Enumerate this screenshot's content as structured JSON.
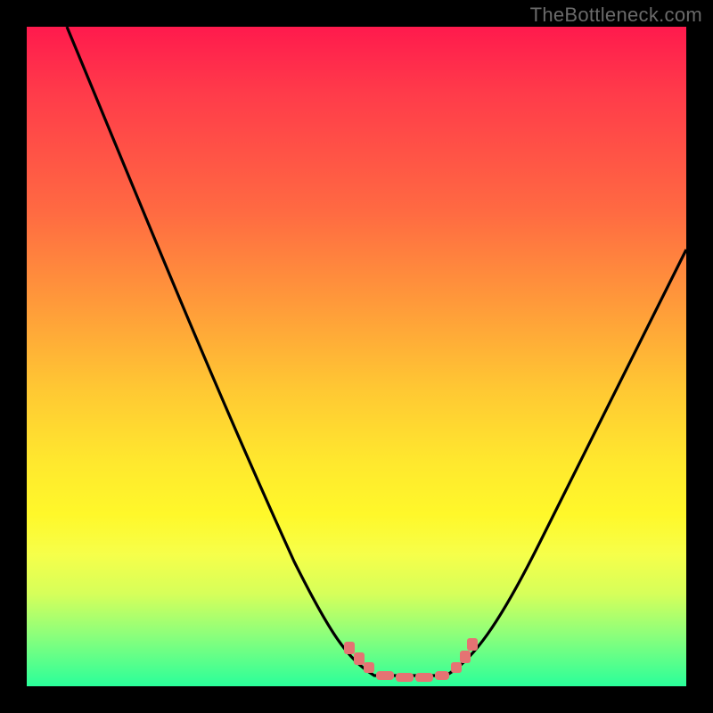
{
  "watermark": "TheBottleneck.com",
  "colors": {
    "frame_background": "#000000",
    "curve_stroke": "#000000",
    "dip_marker": "#e57373",
    "gradient_stops": [
      "#ff1a4d",
      "#ff3b4a",
      "#ff6a42",
      "#ff9a3a",
      "#ffc833",
      "#ffe82e",
      "#fff82a",
      "#f6ff4a",
      "#d6ff5a",
      "#8fff7a",
      "#2aff9a"
    ]
  },
  "chart_data": {
    "type": "line",
    "title": "",
    "xlabel": "",
    "ylabel": "",
    "xlim": [
      0,
      100
    ],
    "ylim": [
      0,
      100
    ],
    "grid": false,
    "legend": false,
    "series": [
      {
        "name": "bottleneck-curve-left",
        "x": [
          6,
          10,
          14,
          18,
          22,
          26,
          30,
          34,
          38,
          42,
          45,
          48,
          50,
          52
        ],
        "y": [
          100,
          90,
          80,
          70,
          60,
          50,
          40,
          31,
          22,
          14,
          8,
          4,
          2,
          1
        ]
      },
      {
        "name": "bottleneck-curve-valley",
        "x": [
          52,
          55,
          58,
          61,
          64
        ],
        "y": [
          1,
          1,
          1,
          1,
          1
        ]
      },
      {
        "name": "bottleneck-curve-right",
        "x": [
          64,
          67,
          70,
          74,
          78,
          82,
          86,
          90,
          94,
          98,
          100
        ],
        "y": [
          1,
          3,
          6,
          11,
          18,
          26,
          34,
          43,
          52,
          61,
          66
        ]
      }
    ],
    "annotations": [
      {
        "name": "dip-marker",
        "x": 49,
        "y": 6
      },
      {
        "name": "dip-marker",
        "x": 50,
        "y": 4
      },
      {
        "name": "dip-marker",
        "x": 51,
        "y": 3
      },
      {
        "name": "dip-marker",
        "x": 53,
        "y": 1
      },
      {
        "name": "dip-marker",
        "x": 56,
        "y": 1
      },
      {
        "name": "dip-marker",
        "x": 59,
        "y": 1
      },
      {
        "name": "dip-marker",
        "x": 62,
        "y": 1
      },
      {
        "name": "dip-marker",
        "x": 64,
        "y": 2
      },
      {
        "name": "dip-marker",
        "x": 66,
        "y": 4
      },
      {
        "name": "dip-marker",
        "x": 67,
        "y": 6
      }
    ]
  }
}
